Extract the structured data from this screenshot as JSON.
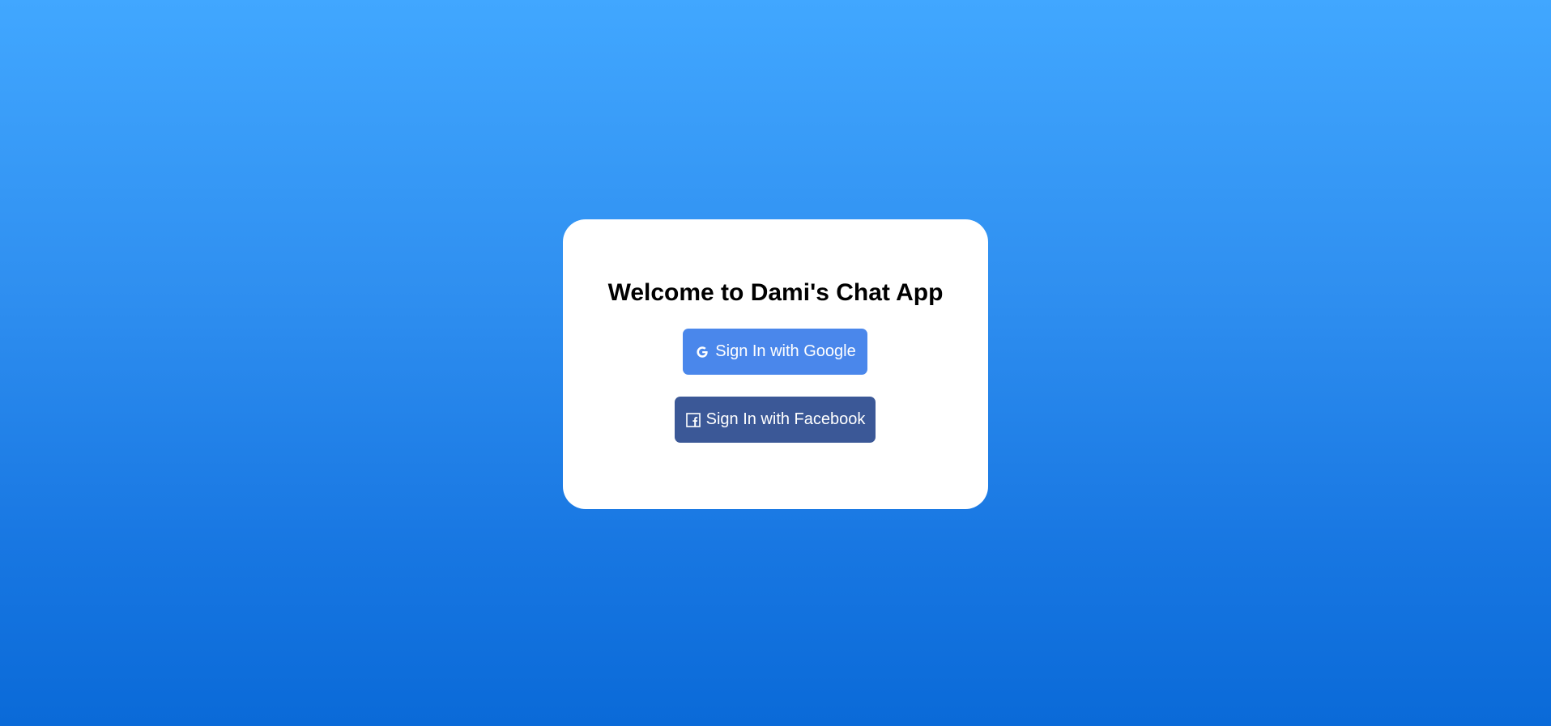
{
  "page": {
    "title": "Welcome to Dami's Chat App",
    "background_top": "#41a7ff",
    "background_bottom": "#0a6ad8"
  },
  "buttons": {
    "google": {
      "label": "Sign In with Google",
      "icon": "google-icon",
      "color": "#4a87eb"
    },
    "facebook": {
      "label": "Sign In with Facebook",
      "icon": "facebook-icon",
      "color": "#3b5897"
    }
  }
}
